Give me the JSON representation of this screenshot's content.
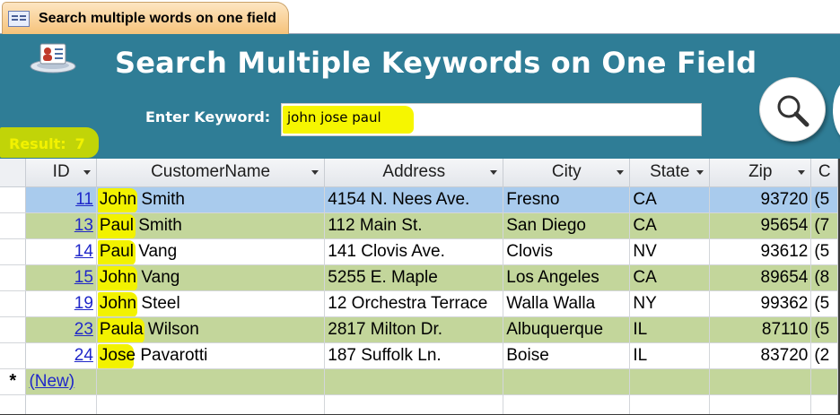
{
  "tab": {
    "label": "Search multiple words on one field"
  },
  "header": {
    "title": "Search Multiple Keywords on One Field",
    "keyword_label": "Enter Keyword:",
    "keyword_value": "john jose paul",
    "result_label": "Result:",
    "result_count": "7"
  },
  "colors": {
    "header_bg": "#2f7d96",
    "highlight": "#f2f200",
    "alt_row": "#c3d69b",
    "current_row": "#a9cbed",
    "link": "#1f27c9"
  },
  "grid": {
    "columns": [
      "ID",
      "CustomerName",
      "Address",
      "City",
      "State",
      "Zip",
      "C"
    ],
    "rows": [
      {
        "id": "11",
        "first": "John",
        "rest": " Smith",
        "address": "4154 N. Nees Ave.",
        "city": "Fresno",
        "state": "CA",
        "zip": "93720",
        "c": "(5"
      },
      {
        "id": "13",
        "first": "Paul",
        "rest": " Smith",
        "address": "112 Main St.",
        "city": "San Diego",
        "state": "CA",
        "zip": "95654",
        "c": "(7"
      },
      {
        "id": "14",
        "first": "Paul",
        "rest": " Vang",
        "address": "141 Clovis Ave.",
        "city": "Clovis",
        "state": "NV",
        "zip": "93612",
        "c": "(5"
      },
      {
        "id": "15",
        "first": "John",
        "rest": " Vang",
        "address": "5255 E. Maple",
        "city": "Los Angeles",
        "state": "CA",
        "zip": "89654",
        "c": "(8"
      },
      {
        "id": "19",
        "first": "John",
        "rest": " Steel",
        "address": "12 Orchestra Terrace",
        "city": "Walla Walla",
        "state": "NY",
        "zip": "99362",
        "c": "(5"
      },
      {
        "id": "23",
        "first": "Paula",
        "rest": " Wilson",
        "address": "2817 Milton Dr.",
        "city": "Albuquerque",
        "state": "IL",
        "zip": "87110",
        "c": "(5"
      },
      {
        "id": "24",
        "first": "Jose",
        "rest": " Pavarotti",
        "address": "187 Suffolk Ln.",
        "city": "Boise",
        "state": "IL",
        "zip": "83720",
        "c": "(2"
      }
    ],
    "new_row_marker": "*",
    "new_row_label": "(New)"
  }
}
